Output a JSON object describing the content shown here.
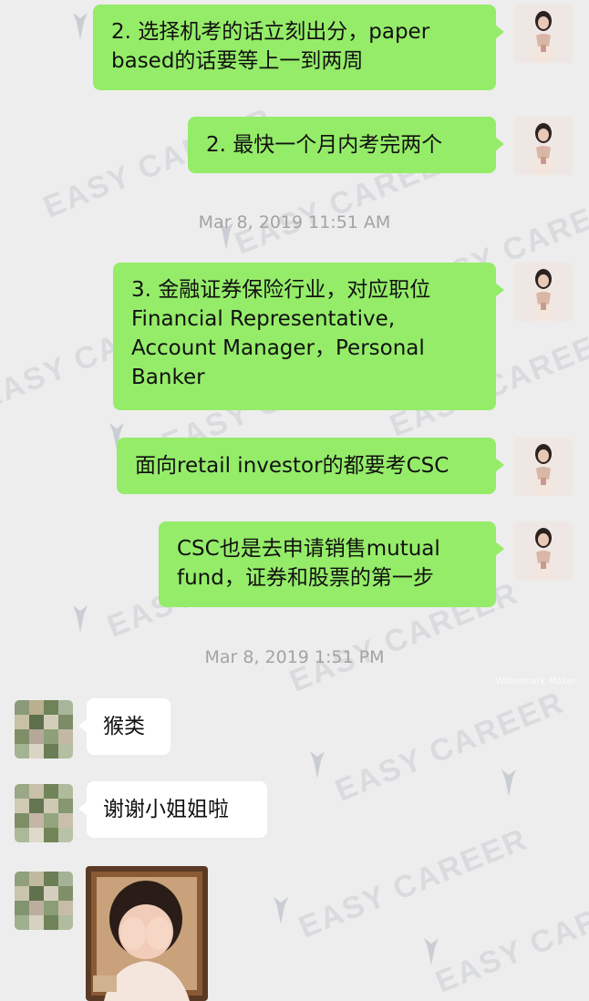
{
  "messages": [
    {
      "id": "m1",
      "lines": "2. 选择机考的话立刻出分，paper\nbased的话要等上一到两周"
    },
    {
      "id": "m2",
      "lines": "2. 最快一个月内考完两个"
    },
    {
      "id": "m3",
      "lines": "3. 金融证券保险行业，对应职位\nFinancial Representative,\nAccount Manager，Personal\nBanker"
    },
    {
      "id": "m4",
      "lines": "面向retail investor的都要考CSC"
    },
    {
      "id": "m5",
      "lines": "CSC也是去申请销售mutual\nfund，证券和股票的第一步"
    },
    {
      "id": "m6",
      "lines": "猴类"
    },
    {
      "id": "m7",
      "lines": "谢谢小姐姐啦"
    }
  ],
  "timestamps": {
    "t1": "Mar 8, 2019 11:51 AM",
    "t2": "Mar 8, 2019 1:51 PM"
  },
  "watermark": {
    "text": "EASY CAREER",
    "logo_icon": "tie-logo-icon",
    "color": "#b4b9c3"
  },
  "small_watermark": "Watermark Maker",
  "colors": {
    "background": "#ededed",
    "sent_bubble": "#95ec69",
    "received_bubble": "#ffffff",
    "timestamp_text": "#a3a3a3"
  }
}
